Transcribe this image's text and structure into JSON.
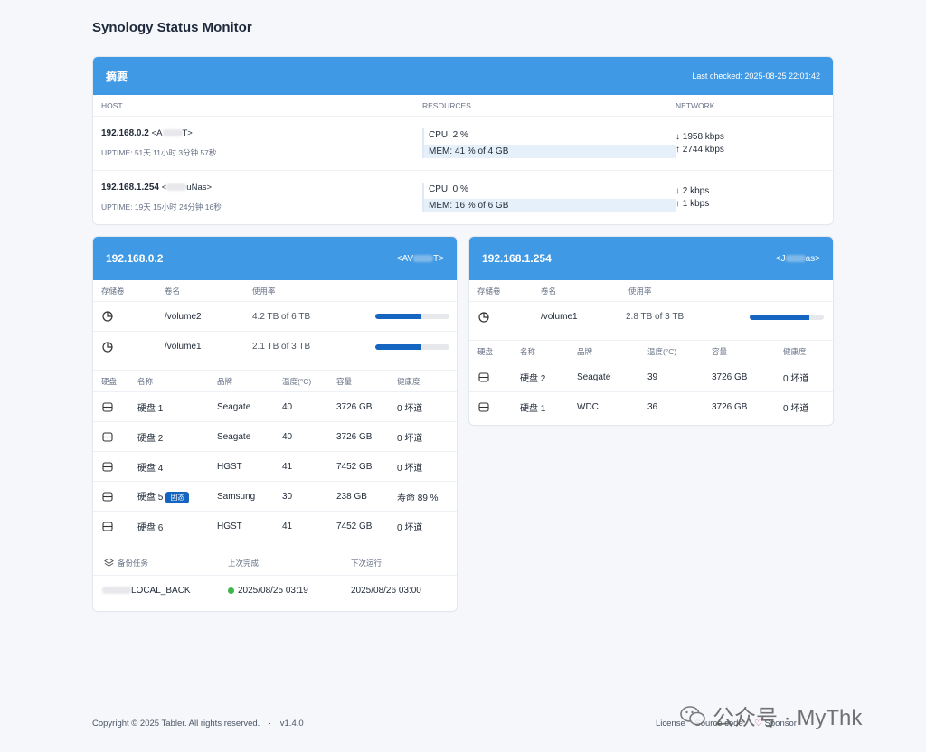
{
  "page": {
    "title": "Synology Status Monitor"
  },
  "summary": {
    "title": "摘要",
    "last_checked": "Last checked: 2025-08-25 22:01:42",
    "columns": {
      "host": "HOST",
      "resources": "RESOURCES",
      "network": "NETWORK"
    },
    "hosts": [
      {
        "ip": "192.168.0.2",
        "alias_pre": "<A",
        "alias_post": "T>",
        "uptime": "UPTIME: 51天 11小时 3分钟 57秒",
        "cpu": "CPU: 2 %",
        "mem": "MEM: 41 % of 4 GB",
        "net_down": "↓ 1958 kbps",
        "net_up": "↑ 2744 kbps"
      },
      {
        "ip": "192.168.1.254",
        "alias_pre": "<",
        "alias_post": "uNas>",
        "uptime": "UPTIME: 19天 15小时 24分钟 16秒",
        "cpu": "CPU: 0 %",
        "mem": "MEM: 16 % of 6 GB",
        "net_down": "↓ 2 kbps",
        "net_up": "↑ 1 kbps"
      }
    ]
  },
  "nas1": {
    "ip": "192.168.0.2",
    "alias_pre": "<AV",
    "alias_post": "T>",
    "volume_headers": {
      "col1": "存储卷",
      "col2": "卷名",
      "col3": "使用率"
    },
    "volumes": [
      {
        "name": "/volume2",
        "usage": "4.2 TB of 6 TB",
        "fraction": 0.62
      },
      {
        "name": "/volume1",
        "usage": "2.1 TB of 3 TB",
        "fraction": 0.62
      }
    ],
    "disk_headers": {
      "col1": "硬盘",
      "col2": "名称",
      "col3": "品牌",
      "col4": "温度(°C)",
      "col5": "容量",
      "col6": "健康度"
    },
    "disks": [
      {
        "name": "硬盘 1",
        "badge": "",
        "brand": "Seagate",
        "temp": "40",
        "capacity": "3726 GB",
        "health": "0 坏道"
      },
      {
        "name": "硬盘 2",
        "badge": "",
        "brand": "Seagate",
        "temp": "40",
        "capacity": "3726 GB",
        "health": "0 坏道"
      },
      {
        "name": "硬盘 4",
        "badge": "",
        "brand": "HGST",
        "temp": "41",
        "capacity": "7452 GB",
        "health": "0 坏道"
      },
      {
        "name": "硬盘 5",
        "badge": "固态",
        "brand": "Samsung",
        "temp": "30",
        "capacity": "238 GB",
        "health": "寿命 89 %"
      },
      {
        "name": "硬盘 6",
        "badge": "",
        "brand": "HGST",
        "temp": "41",
        "capacity": "7452 GB",
        "health": "0 坏道"
      }
    ],
    "backup_headers": {
      "col1": "备份任务",
      "col2": "上次完成",
      "col3": "下次运行"
    },
    "backups": [
      {
        "name_suffix": "LOCAL_BACK",
        "last": "2025/08/25 03:19",
        "next": "2025/08/26 03:00"
      }
    ]
  },
  "nas2": {
    "ip": "192.168.1.254",
    "alias_pre": "<J",
    "alias_post": "as>",
    "volume_headers": {
      "col1": "存储卷",
      "col2": "卷名",
      "col3": "使用率"
    },
    "volumes": [
      {
        "name": "/volume1",
        "usage": "2.8 TB of 3 TB",
        "fraction": 0.8
      }
    ],
    "disk_headers": {
      "col1": "硬盘",
      "col2": "名称",
      "col3": "品牌",
      "col4": "温度(°C)",
      "col5": "容量",
      "col6": "健康度"
    },
    "disks": [
      {
        "name": "硬盘 2",
        "brand": "Seagate",
        "temp": "39",
        "capacity": "3726 GB",
        "health": "0 坏道"
      },
      {
        "name": "硬盘 1",
        "brand": "WDC",
        "temp": "36",
        "capacity": "3726 GB",
        "health": "0 坏道"
      }
    ]
  },
  "footer": {
    "copyright": "Copyright © 2025 Tabler. All rights reserved.",
    "sep": "·",
    "version": "v1.4.0",
    "license": "License",
    "source": "Source code",
    "sponsor": "Sponsor"
  },
  "watermark": {
    "text": "公众号 · MyThk"
  },
  "colors": {
    "header": "#4099e4",
    "bar": "#1566c0",
    "badge": "#1565c0",
    "ok_dot": "#3cb54a"
  }
}
